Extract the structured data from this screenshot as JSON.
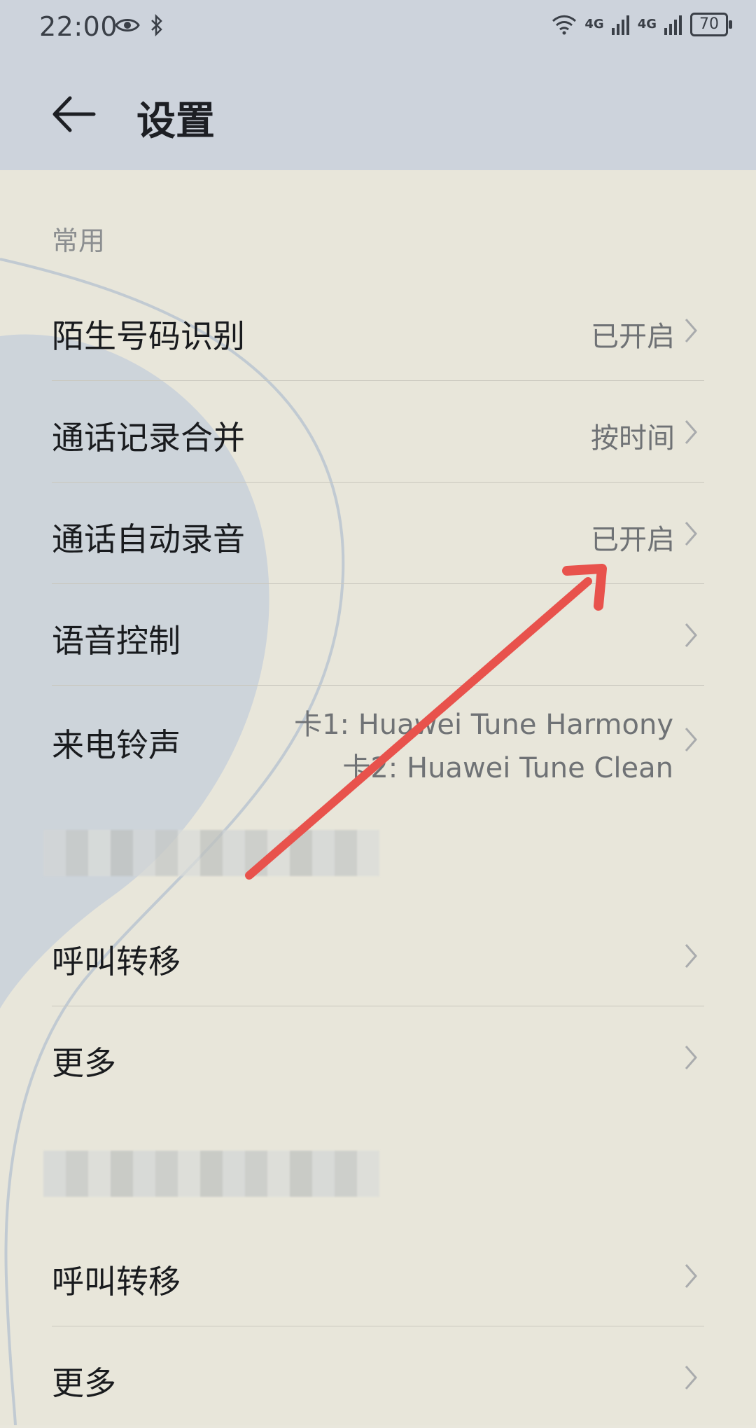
{
  "status_bar": {
    "time": "22:00",
    "icons_left": [
      "eye-icon",
      "bluetooth-icon"
    ],
    "signal_labels": [
      "4G",
      "4G"
    ],
    "battery": "70"
  },
  "header": {
    "back_icon": "arrow-left-icon",
    "title": "设置"
  },
  "sections": {
    "common": {
      "title": "常用",
      "items": [
        {
          "label": "陌生号码识别",
          "value": "已开启"
        },
        {
          "label": "通话记录合并",
          "value": "按时间"
        },
        {
          "label": "通话自动录音",
          "value": "已开启"
        },
        {
          "label": "语音控制",
          "value": ""
        },
        {
          "label": "来电铃声",
          "value_line1": "卡1: Huawei Tune Harmony",
          "value_line2": "卡2: Huawei Tune Clean"
        }
      ]
    },
    "card1": {
      "items": [
        {
          "label": "呼叫转移"
        },
        {
          "label": "更多"
        }
      ]
    },
    "card2": {
      "items": [
        {
          "label": "呼叫转移"
        },
        {
          "label": "更多"
        }
      ]
    }
  },
  "colors": {
    "header_bg": "#cdd3dc",
    "page_bg": "#e9e7dc",
    "annotation_arrow": "#e8524c"
  }
}
